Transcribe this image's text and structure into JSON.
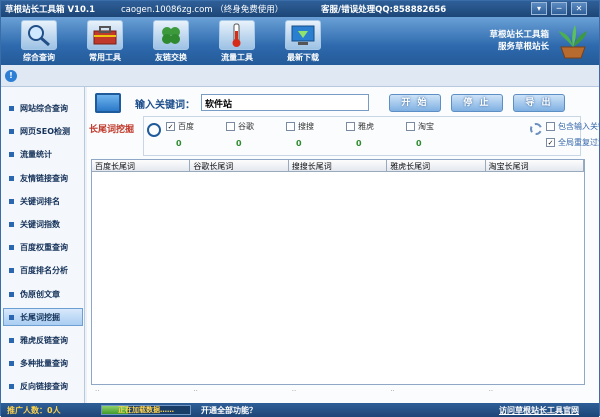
{
  "titlebar": {
    "title": "草根站长工具箱 V10.1",
    "site": "caogen.10086zg.com （终身免费使用）",
    "support": "客服/错误处理QQ:858882656",
    "pin": "▾",
    "minimize": "─",
    "close": "✕"
  },
  "ribbon": {
    "items": [
      {
        "label": "综合查询",
        "icon": "magnifier-icon"
      },
      {
        "label": "常用工具",
        "icon": "toolbox-icon"
      },
      {
        "label": "友链交换",
        "icon": "clover-icon"
      },
      {
        "label": "流量工具",
        "icon": "thermometer-icon"
      },
      {
        "label": "最新下载",
        "icon": "download-icon"
      }
    ],
    "brand_line1": "草根站长工具箱",
    "brand_line2": "服务草根站长"
  },
  "sidebar": {
    "items": [
      {
        "label": "网站综合查询"
      },
      {
        "label": "网页SEO检测"
      },
      {
        "label": "流量统计"
      },
      {
        "label": "友情链接查询"
      },
      {
        "label": "关键词排名"
      },
      {
        "label": "关键词指数"
      },
      {
        "label": "百度权重查询"
      },
      {
        "label": "百度排名分析"
      },
      {
        "label": "伪原创文章"
      },
      {
        "label": "长尾词挖掘"
      },
      {
        "label": "雅虎反链查询"
      },
      {
        "label": "多种批量查询"
      },
      {
        "label": "反向链接查询"
      }
    ],
    "active_index": 9
  },
  "main": {
    "keyword_label": "输入关键词：",
    "keyword_value": "软件站",
    "buttons": {
      "start": "开 始",
      "stop": "停 止",
      "export": "导 出"
    },
    "section_title": "长尾词挖掘",
    "engines": [
      {
        "name": "百度",
        "checked": true,
        "count": "0"
      },
      {
        "name": "谷歌",
        "checked": false,
        "count": "0"
      },
      {
        "name": "搜搜",
        "checked": false,
        "count": "0"
      },
      {
        "name": "雅虎",
        "checked": false,
        "count": "0"
      },
      {
        "name": "淘宝",
        "checked": false,
        "count": "0"
      }
    ],
    "options": [
      {
        "label": "包含输入关键词",
        "checked": false
      },
      {
        "label": "全局重复过滤",
        "checked": true
      }
    ],
    "columns": [
      "百度长尾词",
      "谷歌长尾词",
      "搜搜长尾词",
      "雅虎长尾词",
      "淘宝长尾词"
    ],
    "row_dots": [
      "..",
      "..",
      "..",
      "..",
      ".."
    ]
  },
  "statusbar": {
    "promo_label": "推广人数：0人",
    "progress_text": "正在加载数据……",
    "progress_pct": 30,
    "open_all": "开通全部功能？",
    "visit": "访问草根站长工具官网"
  },
  "colors": {
    "accent": "#2f5f98",
    "active_sidebar": "#a9cdf2",
    "title_red": "#c0392b",
    "count_green": "#2e8b2e"
  }
}
